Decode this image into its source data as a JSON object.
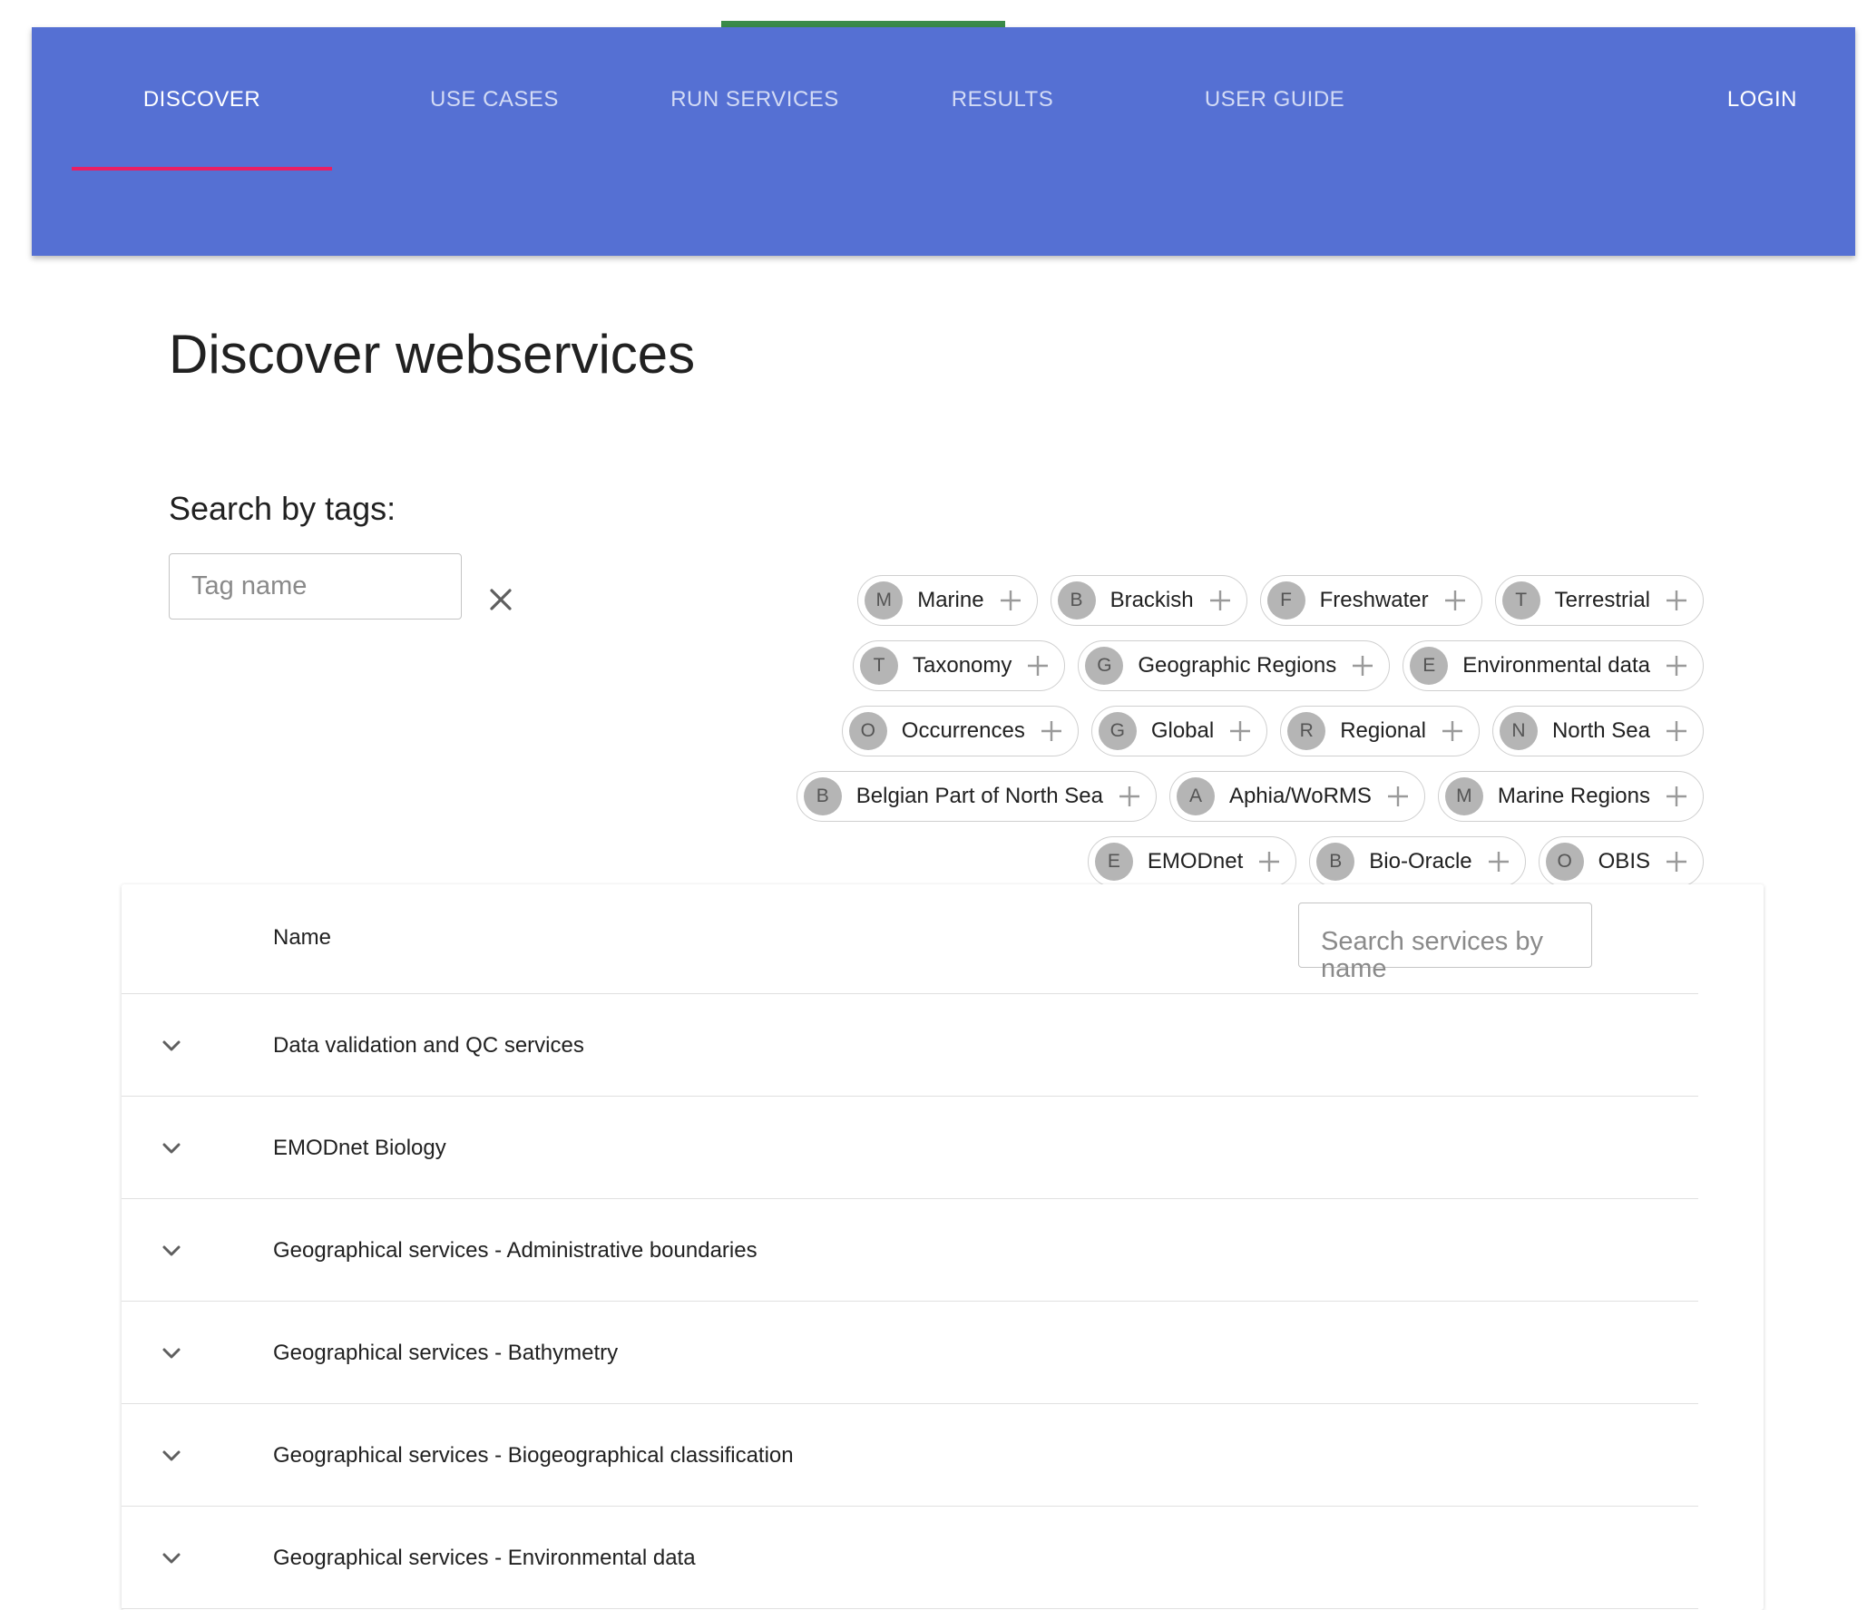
{
  "nav": {
    "tabs": [
      {
        "label": "DISCOVER"
      },
      {
        "label": "USE CASES"
      },
      {
        "label": "RUN SERVICES"
      },
      {
        "label": "RESULTS"
      },
      {
        "label": "USER GUIDE"
      }
    ],
    "active_tab": "DISCOVER",
    "login_label": "LOGIN"
  },
  "page": {
    "title": "Discover webservices"
  },
  "tag_search": {
    "label": "Search by tags:",
    "placeholder": "Tag name",
    "tags": [
      {
        "initial": "M",
        "label": "Marine"
      },
      {
        "initial": "B",
        "label": "Brackish"
      },
      {
        "initial": "F",
        "label": "Freshwater"
      },
      {
        "initial": "T",
        "label": "Terrestrial"
      },
      {
        "initial": "T",
        "label": "Taxonomy"
      },
      {
        "initial": "G",
        "label": "Geographic Regions"
      },
      {
        "initial": "E",
        "label": "Environmental data"
      },
      {
        "initial": "O",
        "label": "Occurrences"
      },
      {
        "initial": "G",
        "label": "Global"
      },
      {
        "initial": "R",
        "label": "Regional"
      },
      {
        "initial": "N",
        "label": "North Sea"
      },
      {
        "initial": "B",
        "label": "Belgian Part of North Sea"
      },
      {
        "initial": "A",
        "label": "Aphia/WoRMS"
      },
      {
        "initial": "M",
        "label": "Marine Regions"
      },
      {
        "initial": "E",
        "label": "EMODnet"
      },
      {
        "initial": "B",
        "label": "Bio-Oracle"
      },
      {
        "initial": "O",
        "label": "OBIS"
      }
    ]
  },
  "services_table": {
    "column_name": "Name",
    "search_placeholder": "Search services by name",
    "rows": [
      {
        "label": "Data validation and QC services"
      },
      {
        "label": "EMODnet Biology"
      },
      {
        "label": "Geographical services - Administrative boundaries"
      },
      {
        "label": "Geographical services - Bathymetry"
      },
      {
        "label": "Geographical services - Biogeographical classification"
      },
      {
        "label": "Geographical services - Environmental data"
      }
    ]
  },
  "colors": {
    "navbar": "#5570d3",
    "tab_indicator": "#e91e63",
    "top_accent": "#3a8b4a"
  }
}
